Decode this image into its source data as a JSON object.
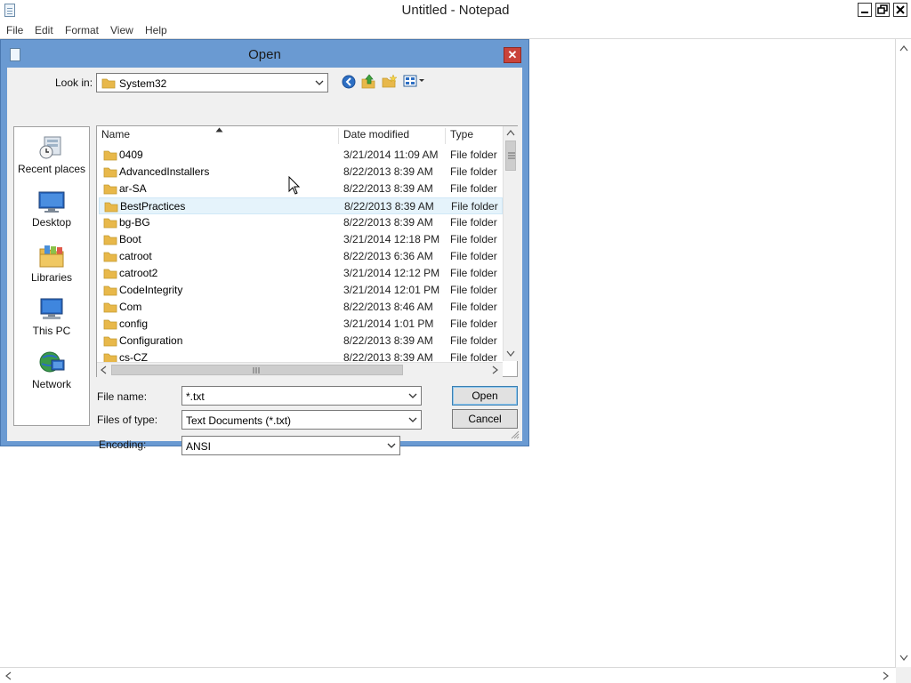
{
  "notepad": {
    "title": "Untitled - Notepad",
    "menu": [
      "File",
      "Edit",
      "Format",
      "View",
      "Help"
    ]
  },
  "dialog": {
    "title": "Open",
    "close_label": "✕",
    "look_in_label": "Look in:",
    "look_in_value": "System32",
    "places": [
      {
        "label": "Recent places",
        "icon": "recent-places-icon"
      },
      {
        "label": "Desktop",
        "icon": "desktop-icon"
      },
      {
        "label": "Libraries",
        "icon": "libraries-icon"
      },
      {
        "label": "This PC",
        "icon": "this-pc-icon"
      },
      {
        "label": "Network",
        "icon": "network-icon"
      }
    ],
    "columns": {
      "name": "Name",
      "date": "Date modified",
      "type": "Type"
    },
    "files": [
      {
        "name": "0409",
        "date": "3/21/2014 11:09 AM",
        "type": "File folder"
      },
      {
        "name": "AdvancedInstallers",
        "date": "8/22/2013 8:39 AM",
        "type": "File folder"
      },
      {
        "name": "ar-SA",
        "date": "8/22/2013 8:39 AM",
        "type": "File folder"
      },
      {
        "name": "BestPractices",
        "date": "8/22/2013 8:39 AM",
        "type": "File folder"
      },
      {
        "name": "bg-BG",
        "date": "8/22/2013 8:39 AM",
        "type": "File folder"
      },
      {
        "name": "Boot",
        "date": "3/21/2014 12:18 PM",
        "type": "File folder"
      },
      {
        "name": "catroot",
        "date": "8/22/2013 6:36 AM",
        "type": "File folder"
      },
      {
        "name": "catroot2",
        "date": "3/21/2014 12:12 PM",
        "type": "File folder"
      },
      {
        "name": "CodeIntegrity",
        "date": "3/21/2014 12:01 PM",
        "type": "File folder"
      },
      {
        "name": "Com",
        "date": "8/22/2013 8:46 AM",
        "type": "File folder"
      },
      {
        "name": "config",
        "date": "3/21/2014 1:01 PM",
        "type": "File folder"
      },
      {
        "name": "Configuration",
        "date": "8/22/2013 8:39 AM",
        "type": "File folder"
      },
      {
        "name": "cs-CZ",
        "date": "8/22/2013 8:39 AM",
        "type": "File folder"
      }
    ],
    "hovered_row": "BestPractices",
    "file_name_label": "File name:",
    "file_name_value": "*.txt",
    "files_of_type_label": "Files of type:",
    "files_of_type_value": "Text Documents (*.txt)",
    "encoding_label": "Encoding:",
    "encoding_value": "ANSI",
    "open_button": "Open",
    "cancel_button": "Cancel"
  },
  "colors": {
    "dialog_frame": "#6a9ad2",
    "close_button": "#c9433a",
    "folder": "#e8b84a",
    "hover_row": "#e5f3fb"
  }
}
